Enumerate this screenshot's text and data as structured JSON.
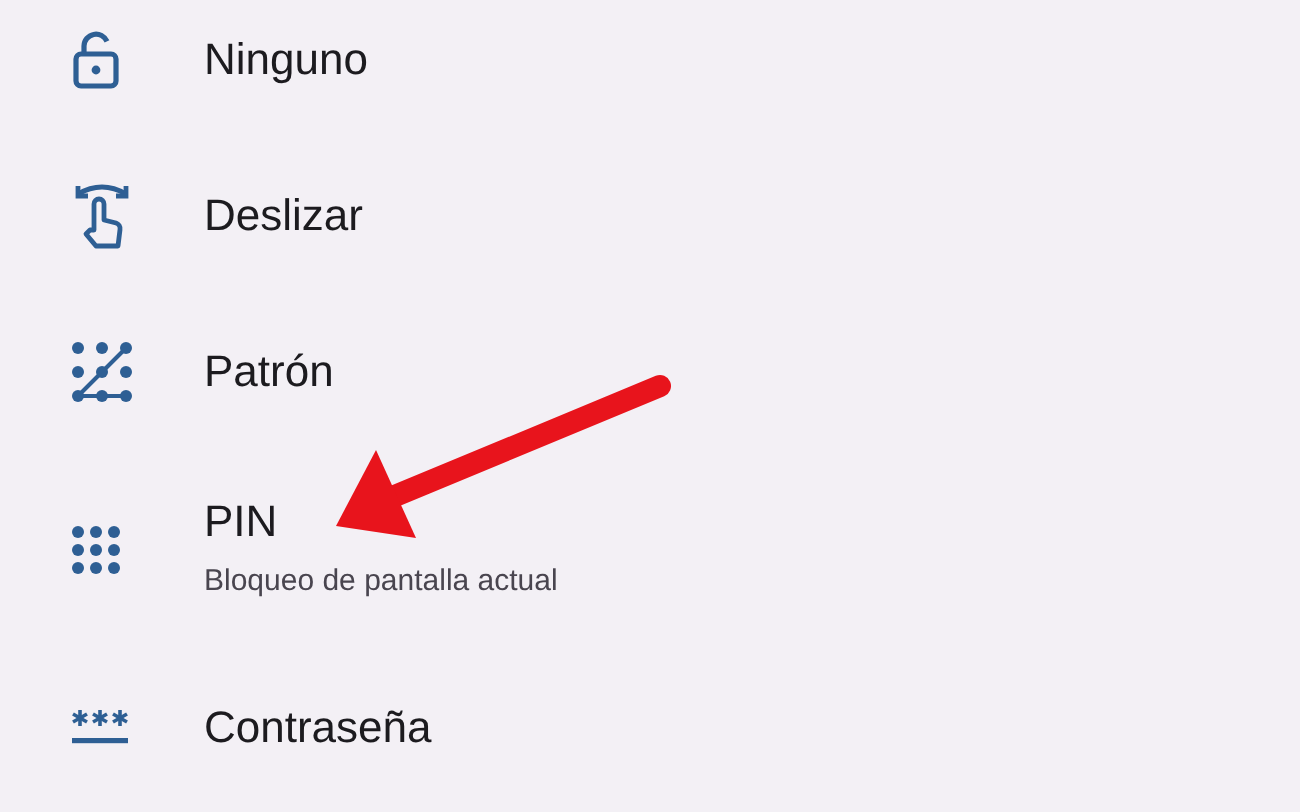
{
  "options": [
    {
      "kind": "none",
      "title": "Ninguno"
    },
    {
      "kind": "swipe",
      "title": "Deslizar"
    },
    {
      "kind": "pattern",
      "title": "Patrón"
    },
    {
      "kind": "pin",
      "title": "PIN",
      "subtitle": "Bloqueo de pantalla actual"
    },
    {
      "kind": "password",
      "title": "Contraseña"
    }
  ]
}
